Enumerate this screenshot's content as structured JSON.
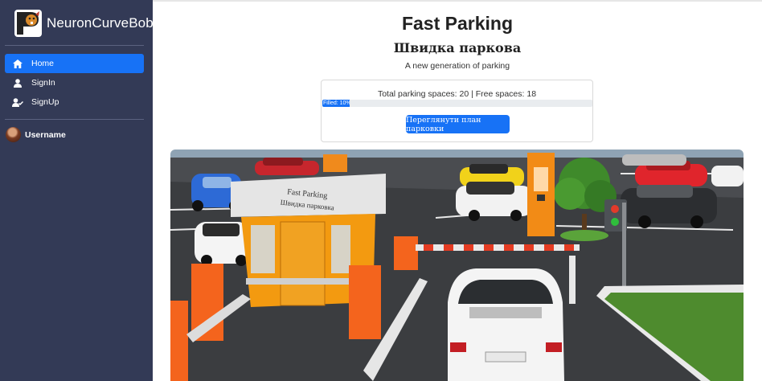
{
  "sidebar": {
    "brand": "NeuronCurveBobr",
    "nav": [
      {
        "label": "Home",
        "icon": "home-icon",
        "active": true
      },
      {
        "label": "SignIn",
        "icon": "user-icon",
        "active": false
      },
      {
        "label": "SignUp",
        "icon": "user-check-icon",
        "active": false
      }
    ],
    "user": {
      "name": "Username"
    }
  },
  "main": {
    "title": "Fast Parking",
    "subtitle": "Швидка паркова",
    "tagline": "A new generation of parking",
    "stats": "Total parking spaces: 20 | Free spaces: 18",
    "progress": {
      "label": "Filled: 10%",
      "percent": 10
    },
    "plan_button": "Переглянути план парковки",
    "hero": {
      "booth_sign_line1": "Fast Parking",
      "booth_sign_line2": "Швидка парковка"
    }
  },
  "colors": {
    "sidebar_bg": "#333a56",
    "accent": "#1772f6"
  }
}
